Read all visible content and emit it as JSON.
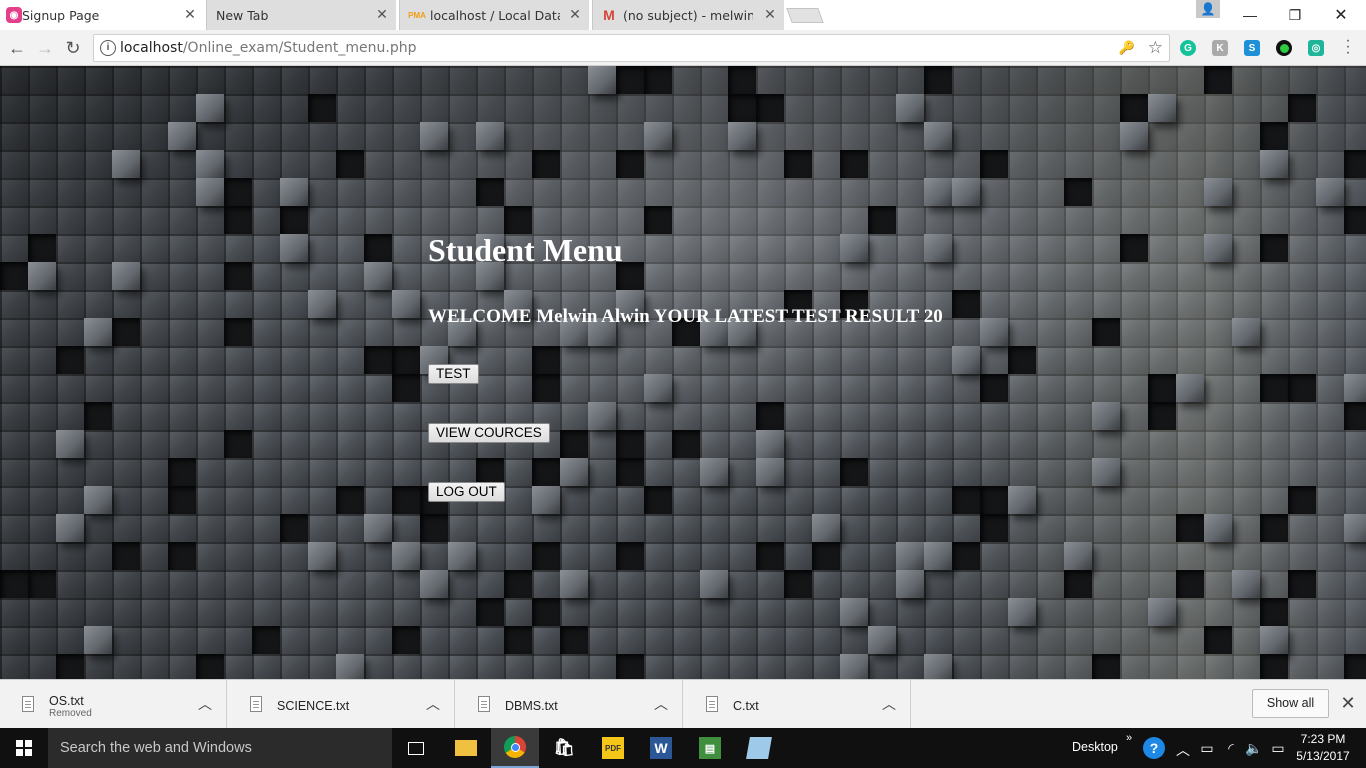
{
  "browser": {
    "tabs": [
      {
        "title": "Signup Page",
        "active": true
      },
      {
        "title": "New Tab",
        "active": false
      },
      {
        "title": "localhost / Local Databas",
        "active": false
      },
      {
        "title": "(no subject) - melwinmp",
        "active": false
      }
    ],
    "url_host": "localhost",
    "url_path": "/Online_exam/Student_menu.php"
  },
  "page": {
    "title": "Student Menu",
    "welcome": "WELCOME Melwin Alwin YOUR LATEST TEST RESULT 20",
    "buttons": {
      "test": "TEST",
      "view_courses": "VIEW COURCES",
      "logout": "LOG OUT"
    }
  },
  "downloads": {
    "items": [
      {
        "name": "OS.txt",
        "status": "Removed"
      },
      {
        "name": "SCIENCE.txt",
        "status": ""
      },
      {
        "name": "DBMS.txt",
        "status": ""
      },
      {
        "name": "C.txt",
        "status": ""
      }
    ],
    "show_all": "Show all"
  },
  "taskbar": {
    "search_placeholder": "Search the web and Windows",
    "desktop_label": "Desktop",
    "time": "7:23 PM",
    "date": "5/13/2017"
  },
  "colors": {
    "signup_favicon": "#e43f8a",
    "gmail_favicon": "#d44638",
    "page_text": "#ffffff"
  }
}
